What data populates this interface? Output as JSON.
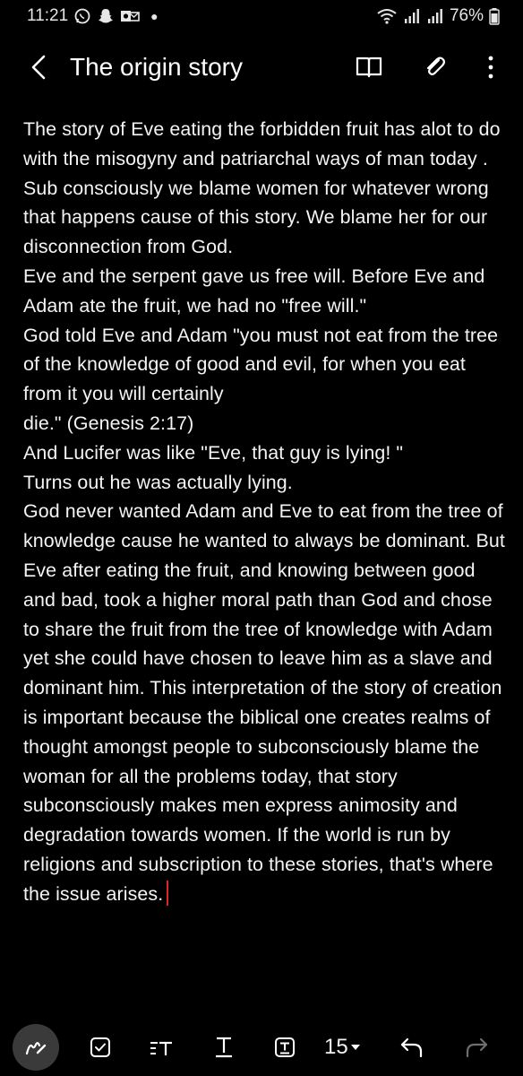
{
  "status_bar": {
    "time": "11:21",
    "battery": "76%",
    "icons": [
      "whatsapp-icon",
      "snapchat-icon",
      "outlook-icon",
      "notification-dot",
      "wifi-icon",
      "signal-icon",
      "signal-icon",
      "battery-icon"
    ]
  },
  "app_bar": {
    "title": "The origin story",
    "icons": [
      "back-icon",
      "reading-mode-icon",
      "attach-icon",
      "more-icon"
    ]
  },
  "note": {
    "paragraphs": [
      "The story of Eve eating the forbidden fruit has alot to do with the misogyny and patriarchal ways of man today . Sub consciously we blame women for whatever wrong that happens cause of this story. We blame her for our disconnection from God.",
      "Eve and the serpent gave us free will. Before Eve and Adam ate the fruit, we had no \"free will.\"",
      "God told Eve and Adam \"you must not eat from the tree of the knowledge of good and evil, for when you eat from it you will certainly",
      "die.\" (Genesis 2:17)",
      "And Lucifer was like \"Eve, that guy is lying! \"",
      "Turns out he was actually lying.",
      "God never wanted Adam and Eve to eat from the tree of knowledge cause he wanted to always be dominant. But Eve after eating the fruit, and knowing between good and bad, took a higher moral path than God and chose to share the fruit from the tree of knowledge with Adam yet she could have chosen to leave him as a slave and dominant him. This interpretation of the story of creation is important because the biblical one creates realms of thought amongst people to subconsciously blame the woman for all the problems today, that story subconsciously makes men express animosity and degradation towards women. If the world is run by religions and subscription to these stories, that's where the issue arises."
    ]
  },
  "toolbar": {
    "font_size": "15",
    "icons": [
      "pen-mode-icon",
      "checkbox-icon",
      "text-style-icon",
      "text-format-icon",
      "text-box-icon",
      "dropdown-arrow-icon",
      "undo-icon",
      "redo-icon"
    ]
  },
  "colors": {
    "background": "#000000",
    "text": "#f4f4f4",
    "cursor": "#e0242c",
    "pen_button": "#3a3a3a",
    "redo_disabled": "#6e6e6e"
  }
}
